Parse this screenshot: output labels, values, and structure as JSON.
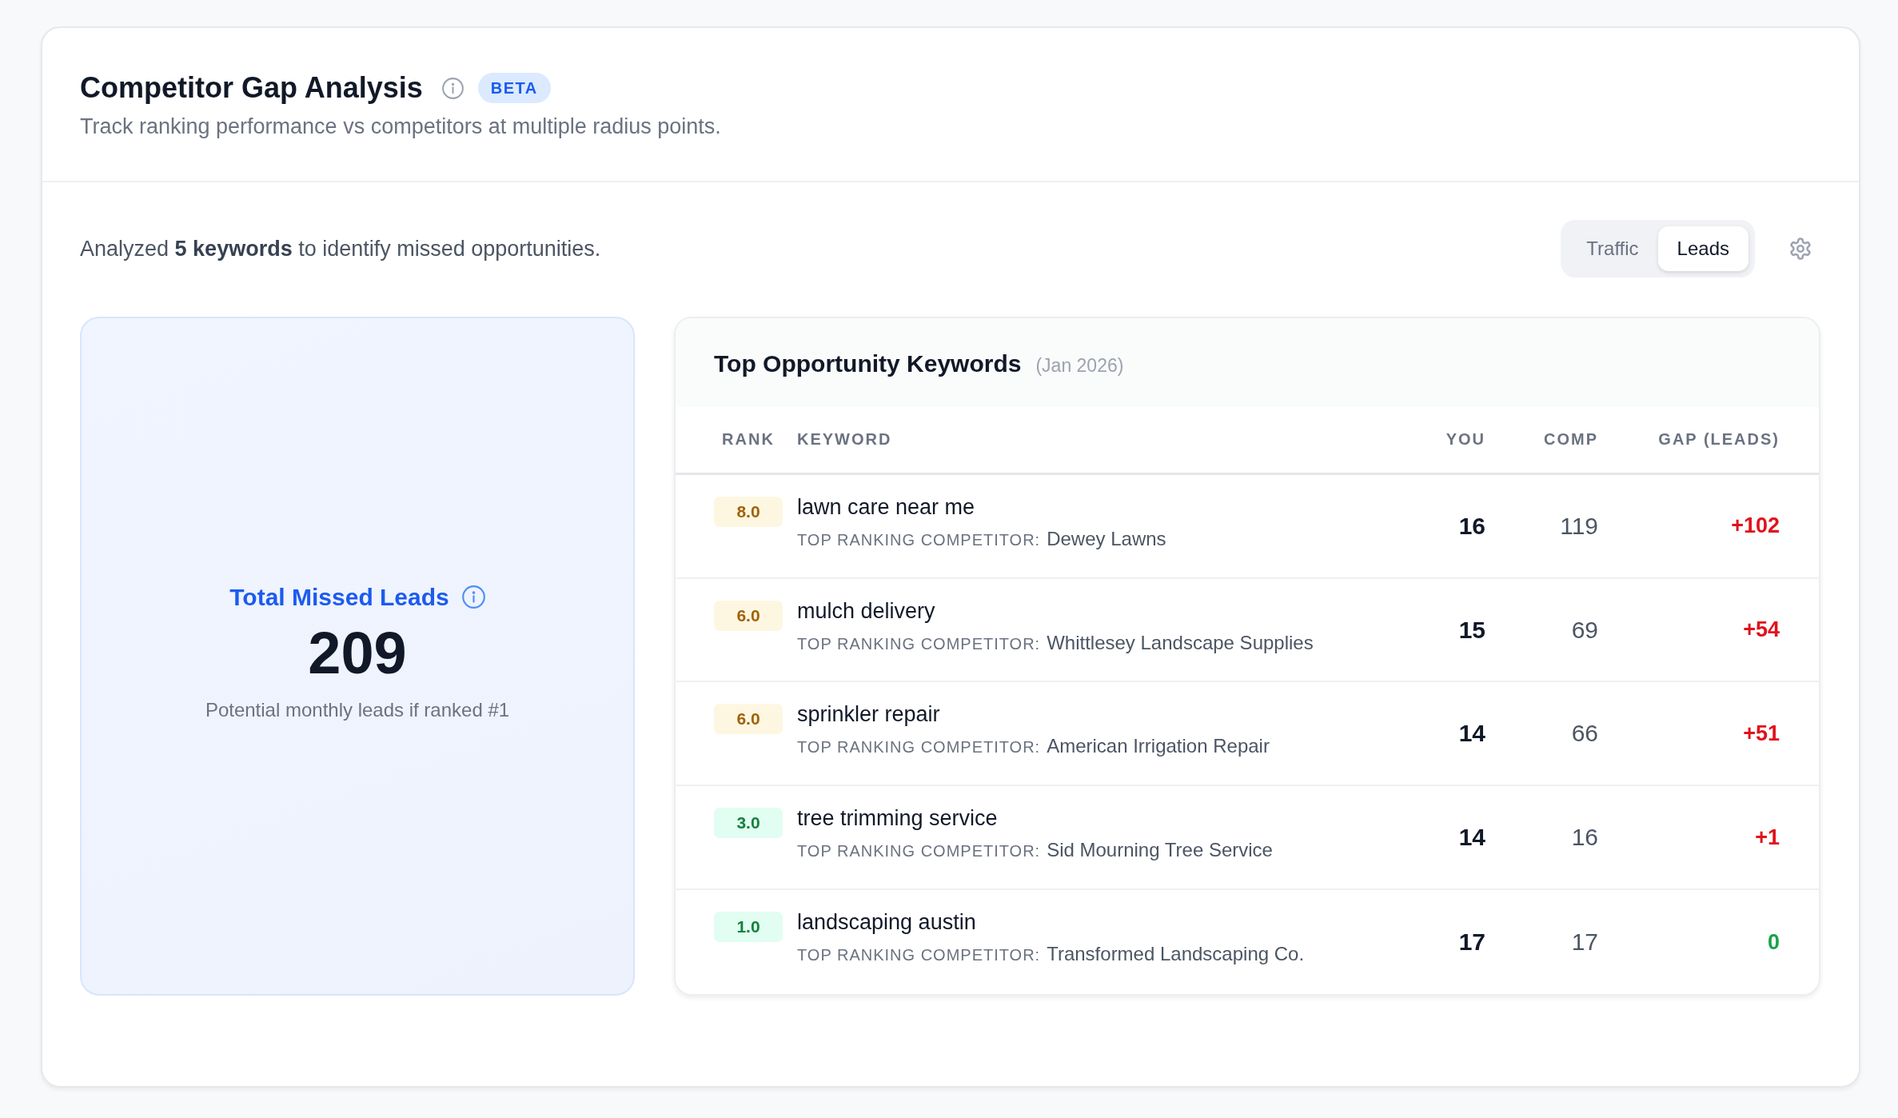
{
  "header": {
    "title": "Competitor Gap Analysis",
    "badge": "BETA",
    "subtitle": "Track ranking performance vs competitors at multiple radius points."
  },
  "summary": "Analyzed **5 keywords** to identify missed opportunities.",
  "view_toggle": [
    {
      "label": "Traffic",
      "selected": false
    },
    {
      "label": "Leads",
      "selected": true
    }
  ],
  "metric": {
    "title": "Total Missed Leads",
    "value": "209",
    "caption": "Potential monthly leads if ranked #1"
  },
  "table": {
    "title": "Top Opportunity Keywords",
    "period": "(Jan 2026)",
    "columns": [
      "RANK",
      "KEYWORD",
      "YOU",
      "COMP",
      "GAP (LEADS)"
    ],
    "rows": [
      {
        "rank": {
          "value": "8.0",
          "color": "#a16207"
        },
        "keyword": "lawn care near me",
        "competitor_label": "TOP RANKING COMPETITOR:",
        "competitor": "Dewey Lawns",
        "you": "16",
        "comp": "119",
        "gap": {
          "value": "+102",
          "color": "#e0121c"
        }
      },
      {
        "rank": {
          "value": "6.0",
          "color": "#a16207"
        },
        "keyword": "mulch delivery",
        "competitor_label": "TOP RANKING COMPETITOR:",
        "competitor": "Whittlesey Landscape Supplies",
        "you": "15",
        "comp": "69",
        "gap": {
          "value": "+54",
          "color": "#e0121c"
        }
      },
      {
        "rank": {
          "value": "6.0",
          "color": "#a16207"
        },
        "keyword": "sprinkler repair",
        "competitor_label": "TOP RANKING COMPETITOR:",
        "competitor": "American Irrigation Repair",
        "you": "14",
        "comp": "66",
        "gap": {
          "value": "+51",
          "color": "#e0121c"
        }
      },
      {
        "rank": {
          "value": "3.0",
          "color": "#15803d"
        },
        "keyword": "tree trimming service",
        "competitor_label": "TOP RANKING COMPETITOR:",
        "competitor": "Sid Mourning Tree Service",
        "you": "14",
        "comp": "16",
        "gap": {
          "value": "+1",
          "color": "#e0121c"
        }
      },
      {
        "rank": {
          "value": "1.0",
          "color": "#15803d"
        },
        "keyword": "landscaping austin",
        "competitor_label": "TOP RANKING COMPETITOR:",
        "competitor": "Transformed Landscaping Co.",
        "you": "17",
        "comp": "17",
        "gap": {
          "value": "0",
          "color": "#16a34a"
        }
      }
    ]
  }
}
